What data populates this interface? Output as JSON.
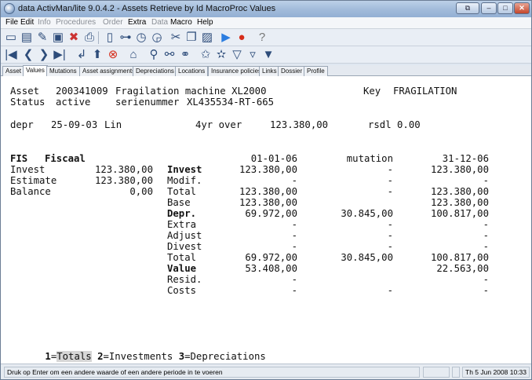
{
  "window": {
    "title": "data ActivMan/lite 9.0.4.2 - Assets Retrieve by Id MacroProc Values"
  },
  "menu": [
    {
      "label": "File",
      "enabled": true
    },
    {
      "label": "Edit",
      "enabled": true
    },
    {
      "label": "Info",
      "enabled": false
    },
    {
      "label": "Procedures",
      "enabled": false
    },
    {
      "label": "Order",
      "enabled": false
    },
    {
      "label": "Extra",
      "enabled": true
    },
    {
      "label": "Data",
      "enabled": false
    },
    {
      "label": "Macro",
      "enabled": true
    },
    {
      "label": "Help",
      "enabled": true
    }
  ],
  "tabs": [
    "Asset",
    "Values",
    "Mutations",
    "Asset assignments",
    "Depreciations",
    "Locations",
    "Insurance policies",
    "Links",
    "Dossier",
    "Profile"
  ],
  "active_tab": "Values",
  "asset": {
    "label": "Asset",
    "id": "200341009",
    "description": "Fragilation machine XL2000",
    "key_label": "Key",
    "key": "FRAGILATION",
    "status_label": "Status",
    "status": "active",
    "serial_label": "serienummer",
    "serial": "XL435534-RT-665"
  },
  "depr_line": {
    "label": "depr",
    "date": "25-09-03",
    "method": "Lin",
    "period": "4yr over",
    "amount": "123.380,00",
    "rsdl": "rsdl 0.00"
  },
  "fis": {
    "label": "FIS",
    "name": "Fiscaal",
    "left_rows": [
      {
        "label": "Invest",
        "value": "123.380,00"
      },
      {
        "label": "Estimate",
        "value": "123.380,00"
      },
      {
        "label": "Balance",
        "value": "0,00"
      }
    ],
    "col_headers": [
      "01-01-06",
      "mutation",
      "31-12-06"
    ],
    "rows": [
      {
        "label": "Invest",
        "bold": true,
        "c1": "123.380,00",
        "c2": "-",
        "c3": "123.380,00"
      },
      {
        "label": "Modif.",
        "bold": false,
        "c1": "-",
        "c2": "-",
        "c3": "-"
      },
      {
        "label": "Total",
        "bold": false,
        "c1": "123.380,00",
        "c2": "-",
        "c3": "123.380,00"
      },
      {
        "label": "Base",
        "bold": false,
        "c1": "123.380,00",
        "c2": "",
        "c3": "123.380,00"
      },
      {
        "label": "Depr.",
        "bold": true,
        "c1": "69.972,00",
        "c2": "30.845,00",
        "c3": "100.817,00"
      },
      {
        "label": "Extra",
        "bold": false,
        "c1": "-",
        "c2": "-",
        "c3": "-"
      },
      {
        "label": "Adjust",
        "bold": false,
        "c1": "-",
        "c2": "-",
        "c3": "-"
      },
      {
        "label": "Divest",
        "bold": false,
        "c1": "-",
        "c2": "-",
        "c3": "-"
      },
      {
        "label": "Total",
        "bold": false,
        "c1": "69.972,00",
        "c2": "30.845,00",
        "c3": "100.817,00"
      },
      {
        "label": "Value",
        "bold": true,
        "c1": "53.408,00",
        "c2": "",
        "c3": "22.563,00"
      },
      {
        "label": "Resid.",
        "bold": false,
        "c1": "-",
        "c2": "",
        "c3": "-"
      },
      {
        "label": "Costs",
        "bold": false,
        "c1": "-",
        "c2": "-",
        "c3": "-"
      }
    ]
  },
  "function_keys": [
    {
      "key": "1",
      "label": "Totals",
      "selected": true
    },
    {
      "key": "2",
      "label": "Investments",
      "selected": false
    },
    {
      "key": "3",
      "label": "Depreciations",
      "selected": false
    }
  ],
  "status": {
    "message": "Druk op Enter om een andere waarde of een andere periode in te voeren",
    "datetime": "Th 5 Jun 2008 10:33"
  },
  "toolbar_icons_row1": [
    "new-doc-icon",
    "new-window-icon",
    "edit-icon",
    "save-icon",
    "delete-icon",
    "print-icon",
    "blank-page-icon",
    "tree-icon",
    "clock-icon",
    "clock2-icon",
    "cut-icon",
    "copy-icon",
    "paste-icon",
    "play-icon",
    "record-icon",
    "help-icon"
  ],
  "toolbar_icons_row2": [
    "first-icon",
    "prev-icon",
    "next-icon",
    "last-icon",
    "back-icon",
    "up-icon",
    "stop-icon",
    "home-icon",
    "search-icon",
    "find-icon",
    "binoculars-icon",
    "star-icon",
    "star2-icon",
    "filter-icon",
    "filter2-icon",
    "filter3-icon"
  ]
}
